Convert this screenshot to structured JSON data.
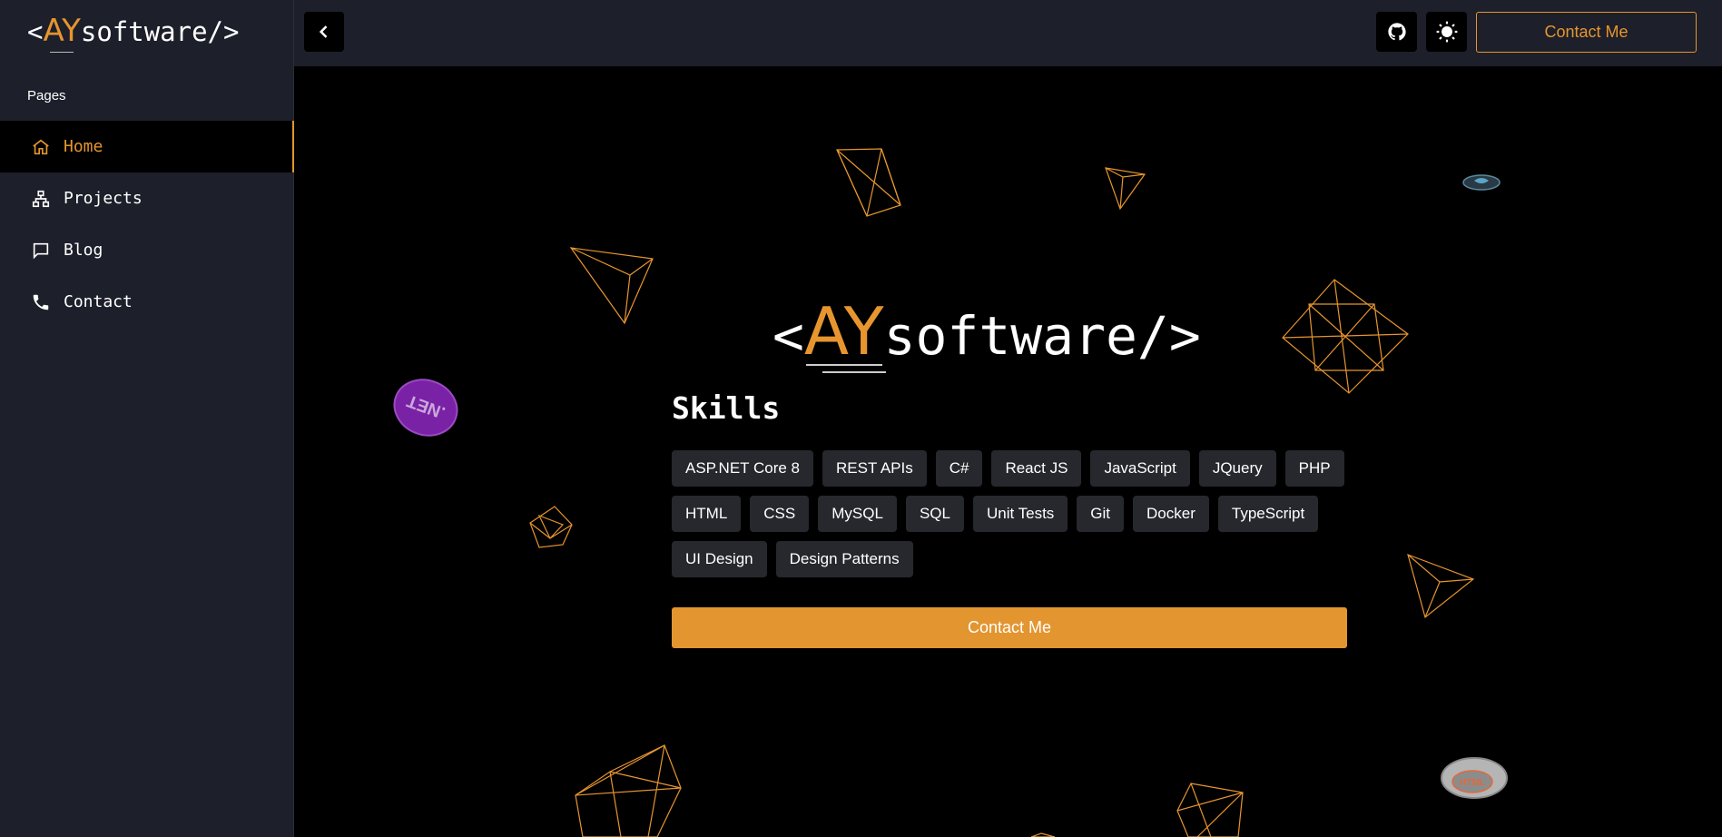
{
  "sidebar": {
    "logo": {
      "open": "<",
      "brand": "AY",
      "rest": "software/>"
    },
    "section_label": "Pages",
    "items": [
      {
        "label": "Home",
        "icon": "home-icon",
        "active": true
      },
      {
        "label": "Projects",
        "icon": "sitemap-icon",
        "active": false
      },
      {
        "label": "Blog",
        "icon": "message-icon",
        "active": false
      },
      {
        "label": "Contact",
        "icon": "phone-icon",
        "active": false
      }
    ]
  },
  "topbar": {
    "back_icon": "chevron-left-icon",
    "github_icon": "github-icon",
    "theme_icon": "sun-icon",
    "contact_label": "Contact Me"
  },
  "hero": {
    "logo": {
      "open": "<",
      "brand": "AY",
      "rest": "software/>"
    },
    "skills_title": "Skills",
    "skills": [
      "ASP.NET Core 8",
      "REST APIs",
      "C#",
      "React JS",
      "JavaScript",
      "JQuery",
      "PHP",
      "HTML",
      "CSS",
      "MySQL",
      "SQL",
      "Unit Tests",
      "Git",
      "Docker",
      "TypeScript",
      "UI Design",
      "Design Patterns"
    ],
    "contact_label": "Contact Me",
    "floating_badges": [
      ".NET",
      "HTML"
    ]
  },
  "colors": {
    "accent": "#e6952f",
    "sidebar_bg": "#1d1f2a",
    "main_bg": "#000000",
    "chip_bg": "#27282d"
  }
}
